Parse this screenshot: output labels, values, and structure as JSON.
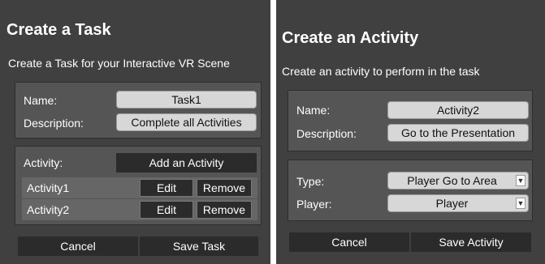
{
  "task_dialog": {
    "title": "Create a Task",
    "subtitle": "Create a Task for your Interactive VR Scene",
    "name_label": "Name:",
    "name_value": "Task1",
    "description_label": "Description:",
    "description_value": "Complete all Activities",
    "activity_label": "Activity:",
    "add_activity_label": "Add an Activity",
    "activities": [
      {
        "label": "Activity1",
        "edit": "Edit",
        "remove": "Remove"
      },
      {
        "label": "Activity2",
        "edit": "Edit",
        "remove": "Remove"
      }
    ],
    "cancel_label": "Cancel",
    "save_label": "Save Task"
  },
  "activity_dialog": {
    "title": "Create an Activity",
    "subtitle": "Create an activity to perform in the task",
    "name_label": "Name:",
    "name_value": "Activity2",
    "description_label": "Description:",
    "description_value": "Go to the Presentation",
    "type_label": "Type:",
    "type_value": "Player Go to Area",
    "player_label": "Player:",
    "player_value": "Player",
    "cancel_label": "Cancel",
    "save_label": "Save Activity"
  },
  "colors": {
    "panel_bg": "#404040",
    "section_bg": "#555555",
    "field_bg": "#d7d7d7",
    "button_dark": "#2b2b2b"
  }
}
